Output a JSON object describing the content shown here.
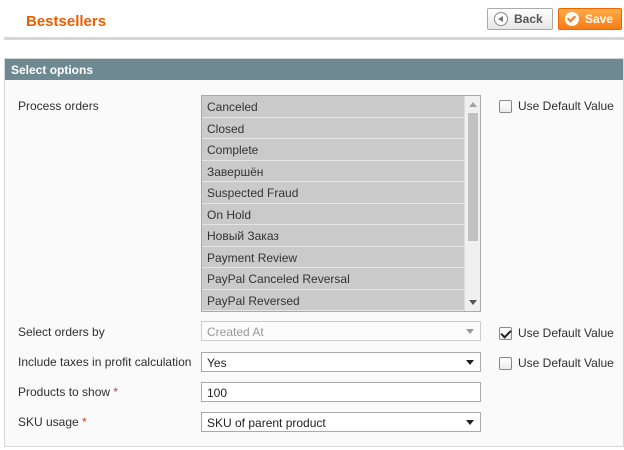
{
  "header": {
    "title": "Bestsellers",
    "back_label": "Back",
    "save_label": "Save"
  },
  "panel": {
    "title": "Select options"
  },
  "process_orders": {
    "label": "Process orders",
    "options": [
      "Canceled",
      "Closed",
      "Complete",
      "Завершён",
      "Suspected Fraud",
      "On Hold",
      "Новый Заказ",
      "Payment Review",
      "PayPal Canceled Reversal",
      "PayPal Reversed"
    ],
    "use_default_label": "Use Default Value",
    "use_default_checked": false
  },
  "select_orders_by": {
    "label": "Select orders by",
    "value": "Created At",
    "use_default_label": "Use Default Value",
    "use_default_checked": true
  },
  "include_taxes": {
    "label": "Include taxes in profit calculation",
    "value": "Yes",
    "use_default_label": "Use Default Value",
    "use_default_checked": false
  },
  "products_to_show": {
    "label": "Products to show",
    "required_mark": "*",
    "value": "100"
  },
  "sku_usage": {
    "label": "SKU usage",
    "required_mark": "*",
    "value": "SKU of parent product"
  },
  "colors": {
    "title": "#eb5e00",
    "panel_header": "#6f8992",
    "save_button": "#f77c16",
    "required": "#eb340a"
  }
}
